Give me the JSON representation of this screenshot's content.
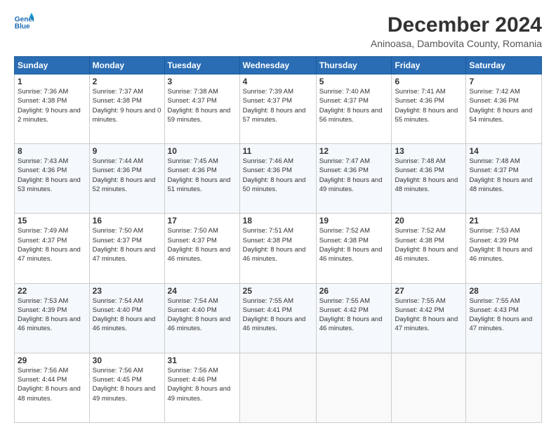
{
  "header": {
    "logo_line1": "General",
    "logo_line2": "Blue",
    "title": "December 2024",
    "subtitle": "Aninoasa, Dambovita County, Romania"
  },
  "days_of_week": [
    "Sunday",
    "Monday",
    "Tuesday",
    "Wednesday",
    "Thursday",
    "Friday",
    "Saturday"
  ],
  "weeks": [
    [
      {
        "day": "1",
        "sunrise": "7:36 AM",
        "sunset": "4:38 PM",
        "daylight": "9 hours and 2 minutes."
      },
      {
        "day": "2",
        "sunrise": "7:37 AM",
        "sunset": "4:38 PM",
        "daylight": "9 hours and 0 minutes."
      },
      {
        "day": "3",
        "sunrise": "7:38 AM",
        "sunset": "4:37 PM",
        "daylight": "8 hours and 59 minutes."
      },
      {
        "day": "4",
        "sunrise": "7:39 AM",
        "sunset": "4:37 PM",
        "daylight": "8 hours and 57 minutes."
      },
      {
        "day": "5",
        "sunrise": "7:40 AM",
        "sunset": "4:37 PM",
        "daylight": "8 hours and 56 minutes."
      },
      {
        "day": "6",
        "sunrise": "7:41 AM",
        "sunset": "4:36 PM",
        "daylight": "8 hours and 55 minutes."
      },
      {
        "day": "7",
        "sunrise": "7:42 AM",
        "sunset": "4:36 PM",
        "daylight": "8 hours and 54 minutes."
      }
    ],
    [
      {
        "day": "8",
        "sunrise": "7:43 AM",
        "sunset": "4:36 PM",
        "daylight": "8 hours and 53 minutes."
      },
      {
        "day": "9",
        "sunrise": "7:44 AM",
        "sunset": "4:36 PM",
        "daylight": "8 hours and 52 minutes."
      },
      {
        "day": "10",
        "sunrise": "7:45 AM",
        "sunset": "4:36 PM",
        "daylight": "8 hours and 51 minutes."
      },
      {
        "day": "11",
        "sunrise": "7:46 AM",
        "sunset": "4:36 PM",
        "daylight": "8 hours and 50 minutes."
      },
      {
        "day": "12",
        "sunrise": "7:47 AM",
        "sunset": "4:36 PM",
        "daylight": "8 hours and 49 minutes."
      },
      {
        "day": "13",
        "sunrise": "7:48 AM",
        "sunset": "4:36 PM",
        "daylight": "8 hours and 48 minutes."
      },
      {
        "day": "14",
        "sunrise": "7:48 AM",
        "sunset": "4:37 PM",
        "daylight": "8 hours and 48 minutes."
      }
    ],
    [
      {
        "day": "15",
        "sunrise": "7:49 AM",
        "sunset": "4:37 PM",
        "daylight": "8 hours and 47 minutes."
      },
      {
        "day": "16",
        "sunrise": "7:50 AM",
        "sunset": "4:37 PM",
        "daylight": "8 hours and 47 minutes."
      },
      {
        "day": "17",
        "sunrise": "7:50 AM",
        "sunset": "4:37 PM",
        "daylight": "8 hours and 46 minutes."
      },
      {
        "day": "18",
        "sunrise": "7:51 AM",
        "sunset": "4:38 PM",
        "daylight": "8 hours and 46 minutes."
      },
      {
        "day": "19",
        "sunrise": "7:52 AM",
        "sunset": "4:38 PM",
        "daylight": "8 hours and 46 minutes."
      },
      {
        "day": "20",
        "sunrise": "7:52 AM",
        "sunset": "4:38 PM",
        "daylight": "8 hours and 46 minutes."
      },
      {
        "day": "21",
        "sunrise": "7:53 AM",
        "sunset": "4:39 PM",
        "daylight": "8 hours and 46 minutes."
      }
    ],
    [
      {
        "day": "22",
        "sunrise": "7:53 AM",
        "sunset": "4:39 PM",
        "daylight": "8 hours and 46 minutes."
      },
      {
        "day": "23",
        "sunrise": "7:54 AM",
        "sunset": "4:40 PM",
        "daylight": "8 hours and 46 minutes."
      },
      {
        "day": "24",
        "sunrise": "7:54 AM",
        "sunset": "4:40 PM",
        "daylight": "8 hours and 46 minutes."
      },
      {
        "day": "25",
        "sunrise": "7:55 AM",
        "sunset": "4:41 PM",
        "daylight": "8 hours and 46 minutes."
      },
      {
        "day": "26",
        "sunrise": "7:55 AM",
        "sunset": "4:42 PM",
        "daylight": "8 hours and 46 minutes."
      },
      {
        "day": "27",
        "sunrise": "7:55 AM",
        "sunset": "4:42 PM",
        "daylight": "8 hours and 47 minutes."
      },
      {
        "day": "28",
        "sunrise": "7:55 AM",
        "sunset": "4:43 PM",
        "daylight": "8 hours and 47 minutes."
      }
    ],
    [
      {
        "day": "29",
        "sunrise": "7:56 AM",
        "sunset": "4:44 PM",
        "daylight": "8 hours and 48 minutes."
      },
      {
        "day": "30",
        "sunrise": "7:56 AM",
        "sunset": "4:45 PM",
        "daylight": "8 hours and 49 minutes."
      },
      {
        "day": "31",
        "sunrise": "7:56 AM",
        "sunset": "4:46 PM",
        "daylight": "8 hours and 49 minutes."
      },
      null,
      null,
      null,
      null
    ]
  ],
  "labels": {
    "sunrise": "Sunrise:",
    "sunset": "Sunset:",
    "daylight": "Daylight:"
  }
}
